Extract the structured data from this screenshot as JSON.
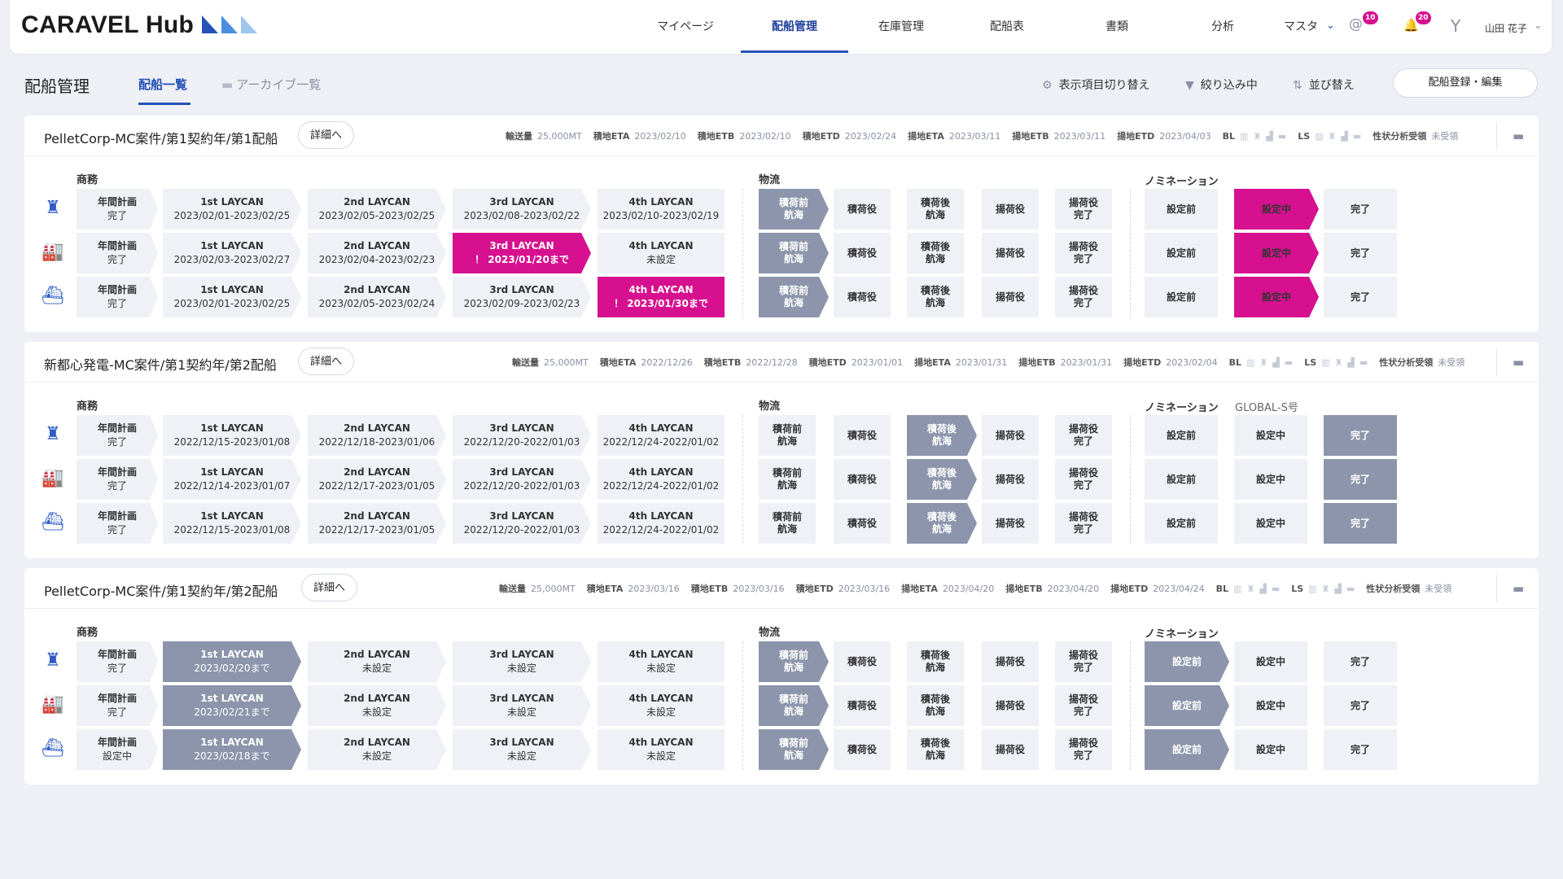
{
  "app": {
    "logo": "CARAVEL Hub",
    "nav": [
      "マイページ",
      "配船管理",
      "在庫管理",
      "配船表",
      "書類",
      "分析",
      "マスタ"
    ],
    "mentions_count": "10",
    "notifications_count": "20",
    "user_name": "山田 花子"
  },
  "page": {
    "title": "配船管理",
    "tabs": [
      "配船一覧",
      "アーカイブ一覧"
    ],
    "tools": [
      "表示項目切り替え",
      "絞り込み中",
      "並び替え"
    ],
    "register_button": "配船登録・編集"
  },
  "labels": {
    "detail": "詳細へ",
    "business": "商務",
    "logistics": "物流",
    "nomination": "ノミネーション",
    "volume": "輸送量",
    "load_eta": "積地ETA",
    "load_etb": "積地ETB",
    "load_etd": "積地ETD",
    "disc_eta": "揚地ETA",
    "disc_etb": "揚地ETB",
    "disc_etd": "揚地ETD",
    "bl": "BL",
    "ls": "LS",
    "analysis_label": "性状分析受領",
    "analysis_value": "未受領"
  },
  "cards": [
    {
      "title": "PelletCorp-MC案件/第1契約年/第1配船",
      "volume": "25,000MT",
      "load_eta": "2023/02/10",
      "load_etb": "2023/02/10",
      "load_etd": "2023/02/24",
      "disc_eta": "2023/03/11",
      "disc_etb": "2023/03/11",
      "disc_etd": "2023/04/03",
      "nomination_value": "",
      "rows": [
        {
          "icon": "chess-pieces-icon",
          "annual": [
            "年間計画",
            "完了",
            ""
          ],
          "laycan": [
            [
              "1st LAYCAN",
              "2023/02/01-2023/02/25",
              ""
            ],
            [
              "2nd LAYCAN",
              "2023/02/05-2023/02/25",
              ""
            ],
            [
              "3rd LAYCAN",
              "2023/02/08-2023/02/22",
              ""
            ],
            [
              "4th LAYCAN",
              "2023/02/10-2023/02/19",
              ""
            ]
          ],
          "logistics": [
            [
              "積荷前\n航海",
              "gray"
            ],
            [
              "積荷役",
              ""
            ],
            [
              "積荷後\n航海",
              ""
            ],
            [
              "揚荷役",
              ""
            ],
            [
              "揚荷役\n完了",
              ""
            ]
          ],
          "nomination": [
            [
              "設定前",
              ""
            ],
            [
              "設定中",
              "pink"
            ],
            [
              "完了",
              ""
            ]
          ]
        },
        {
          "icon": "factory-icon",
          "annual": [
            "年間計画",
            "完了",
            ""
          ],
          "laycan": [
            [
              "1st LAYCAN",
              "2023/02/03-2023/02/27",
              ""
            ],
            [
              "2nd LAYCAN",
              "2023/02/04-2023/02/23",
              ""
            ],
            [
              "3rd LAYCAN",
              "！ 2023/01/20まで",
              "pink"
            ],
            [
              "4th LAYCAN",
              "未設定",
              ""
            ]
          ],
          "logistics": [
            [
              "積荷前\n航海",
              "gray"
            ],
            [
              "積荷役",
              ""
            ],
            [
              "積荷後\n航海",
              ""
            ],
            [
              "揚荷役",
              ""
            ],
            [
              "揚荷役\n完了",
              ""
            ]
          ],
          "nomination": [
            [
              "設定前",
              ""
            ],
            [
              "設定中",
              "pink"
            ],
            [
              "完了",
              ""
            ]
          ]
        },
        {
          "icon": "ship-icon",
          "annual": [
            "年間計画",
            "完了",
            ""
          ],
          "laycan": [
            [
              "1st LAYCAN",
              "2023/02/01-2023/02/25",
              ""
            ],
            [
              "2nd LAYCAN",
              "2023/02/05-2023/02/24",
              ""
            ],
            [
              "3rd LAYCAN",
              "2023/02/09-2023/02/23",
              ""
            ],
            [
              "4th LAYCAN",
              "！ 2023/01/30まで",
              "pink"
            ]
          ],
          "logistics": [
            [
              "積荷前\n航海",
              "gray"
            ],
            [
              "積荷役",
              ""
            ],
            [
              "積荷後\n航海",
              ""
            ],
            [
              "揚荷役",
              ""
            ],
            [
              "揚荷役\n完了",
              ""
            ]
          ],
          "nomination": [
            [
              "設定前",
              ""
            ],
            [
              "設定中",
              "pink"
            ],
            [
              "完了",
              ""
            ]
          ]
        }
      ]
    },
    {
      "title": "新都心発電-MC案件/第1契約年/第2配船",
      "volume": "25,000MT",
      "load_eta": "2022/12/26",
      "load_etb": "2022/12/28",
      "load_etd": "2023/01/01",
      "disc_eta": "2023/01/31",
      "disc_etb": "2023/01/31",
      "disc_etd": "2023/02/04",
      "nomination_value": "GLOBAL-S号",
      "rows": [
        {
          "icon": "chess-pieces-icon",
          "annual": [
            "年間計画",
            "完了",
            ""
          ],
          "laycan": [
            [
              "1st LAYCAN",
              "2022/12/15-2023/01/08",
              ""
            ],
            [
              "2nd LAYCAN",
              "2022/12/18-2023/01/06",
              ""
            ],
            [
              "3rd LAYCAN",
              "2022/12/20-2022/01/03",
              ""
            ],
            [
              "4th LAYCAN",
              "2022/12/24-2022/01/02",
              ""
            ]
          ],
          "logistics": [
            [
              "積荷前\n航海",
              ""
            ],
            [
              "積荷役",
              ""
            ],
            [
              "積荷後\n航海",
              "gray"
            ],
            [
              "揚荷役",
              ""
            ],
            [
              "揚荷役\n完了",
              ""
            ]
          ],
          "nomination": [
            [
              "設定前",
              ""
            ],
            [
              "設定中",
              ""
            ],
            [
              "完了",
              "gray"
            ]
          ]
        },
        {
          "icon": "factory-icon",
          "annual": [
            "年間計画",
            "完了",
            ""
          ],
          "laycan": [
            [
              "1st LAYCAN",
              "2022/12/14-2023/01/07",
              ""
            ],
            [
              "2nd LAYCAN",
              "2022/12/17-2023/01/05",
              ""
            ],
            [
              "3rd LAYCAN",
              "2022/12/20-2022/01/03",
              ""
            ],
            [
              "4th LAYCAN",
              "2022/12/24-2022/01/02",
              ""
            ]
          ],
          "logistics": [
            [
              "積荷前\n航海",
              ""
            ],
            [
              "積荷役",
              ""
            ],
            [
              "積荷後\n航海",
              "gray"
            ],
            [
              "揚荷役",
              ""
            ],
            [
              "揚荷役\n完了",
              ""
            ]
          ],
          "nomination": [
            [
              "設定前",
              ""
            ],
            [
              "設定中",
              ""
            ],
            [
              "完了",
              "gray"
            ]
          ]
        },
        {
          "icon": "ship-icon",
          "annual": [
            "年間計画",
            "完了",
            ""
          ],
          "laycan": [
            [
              "1st LAYCAN",
              "2022/12/15-2023/01/08",
              ""
            ],
            [
              "2nd LAYCAN",
              "2022/12/17-2023/01/05",
              ""
            ],
            [
              "3rd LAYCAN",
              "2022/12/20-2022/01/03",
              ""
            ],
            [
              "4th LAYCAN",
              "2022/12/24-2022/01/02",
              ""
            ]
          ],
          "logistics": [
            [
              "積荷前\n航海",
              ""
            ],
            [
              "積荷役",
              ""
            ],
            [
              "積荷後\n航海",
              "gray"
            ],
            [
              "揚荷役",
              ""
            ],
            [
              "揚荷役\n完了",
              ""
            ]
          ],
          "nomination": [
            [
              "設定前",
              ""
            ],
            [
              "設定中",
              ""
            ],
            [
              "完了",
              "gray"
            ]
          ]
        }
      ]
    },
    {
      "title": "PelletCorp-MC案件/第1契約年/第2配船",
      "volume": "25,000MT",
      "load_eta": "2023/03/16",
      "load_etb": "2023/03/16",
      "load_etd": "2023/03/16",
      "disc_eta": "2023/04/20",
      "disc_etb": "2023/04/20",
      "disc_etd": "2023/04/24",
      "nomination_value": "",
      "rows": [
        {
          "icon": "chess-pieces-icon",
          "annual": [
            "年間計画",
            "完了",
            ""
          ],
          "laycan": [
            [
              "1st LAYCAN",
              "2023/02/20まで",
              "gray"
            ],
            [
              "2nd LAYCAN",
              "未設定",
              ""
            ],
            [
              "3rd LAYCAN",
              "未設定",
              ""
            ],
            [
              "4th LAYCAN",
              "未設定",
              ""
            ]
          ],
          "logistics": [
            [
              "積荷前\n航海",
              "gray"
            ],
            [
              "積荷役",
              ""
            ],
            [
              "積荷後\n航海",
              ""
            ],
            [
              "揚荷役",
              ""
            ],
            [
              "揚荷役\n完了",
              ""
            ]
          ],
          "nomination": [
            [
              "設定前",
              "gray"
            ],
            [
              "設定中",
              ""
            ],
            [
              "完了",
              ""
            ]
          ]
        },
        {
          "icon": "factory-icon",
          "annual": [
            "年間計画",
            "完了",
            ""
          ],
          "laycan": [
            [
              "1st LAYCAN",
              "2023/02/21まで",
              "gray"
            ],
            [
              "2nd LAYCAN",
              "未設定",
              ""
            ],
            [
              "3rd LAYCAN",
              "未設定",
              ""
            ],
            [
              "4th LAYCAN",
              "未設定",
              ""
            ]
          ],
          "logistics": [
            [
              "積荷前\n航海",
              "gray"
            ],
            [
              "積荷役",
              ""
            ],
            [
              "積荷後\n航海",
              ""
            ],
            [
              "揚荷役",
              ""
            ],
            [
              "揚荷役\n完了",
              ""
            ]
          ],
          "nomination": [
            [
              "設定前",
              "gray"
            ],
            [
              "設定中",
              ""
            ],
            [
              "完了",
              ""
            ]
          ]
        },
        {
          "icon": "ship-icon",
          "annual": [
            "年間計画",
            "設定中",
            ""
          ],
          "laycan": [
            [
              "1st LAYCAN",
              "2023/02/18まで",
              "gray"
            ],
            [
              "2nd LAYCAN",
              "未設定",
              ""
            ],
            [
              "3rd LAYCAN",
              "未設定",
              ""
            ],
            [
              "4th LAYCAN",
              "未設定",
              ""
            ]
          ],
          "logistics": [
            [
              "積荷前\n航海",
              "gray"
            ],
            [
              "積荷役",
              ""
            ],
            [
              "積荷後\n航海",
              ""
            ],
            [
              "揚荷役",
              ""
            ],
            [
              "揚荷役\n完了",
              ""
            ]
          ],
          "nomination": [
            [
              "設定前",
              "gray"
            ],
            [
              "設定中",
              ""
            ],
            [
              "完了",
              ""
            ]
          ]
        }
      ]
    }
  ],
  "colors": {
    "accent": "#2452b8",
    "alert": "#d6108f",
    "step_active": "#8c95ab",
    "step_idle": "#eff1f6",
    "background": "#eef0f6"
  }
}
